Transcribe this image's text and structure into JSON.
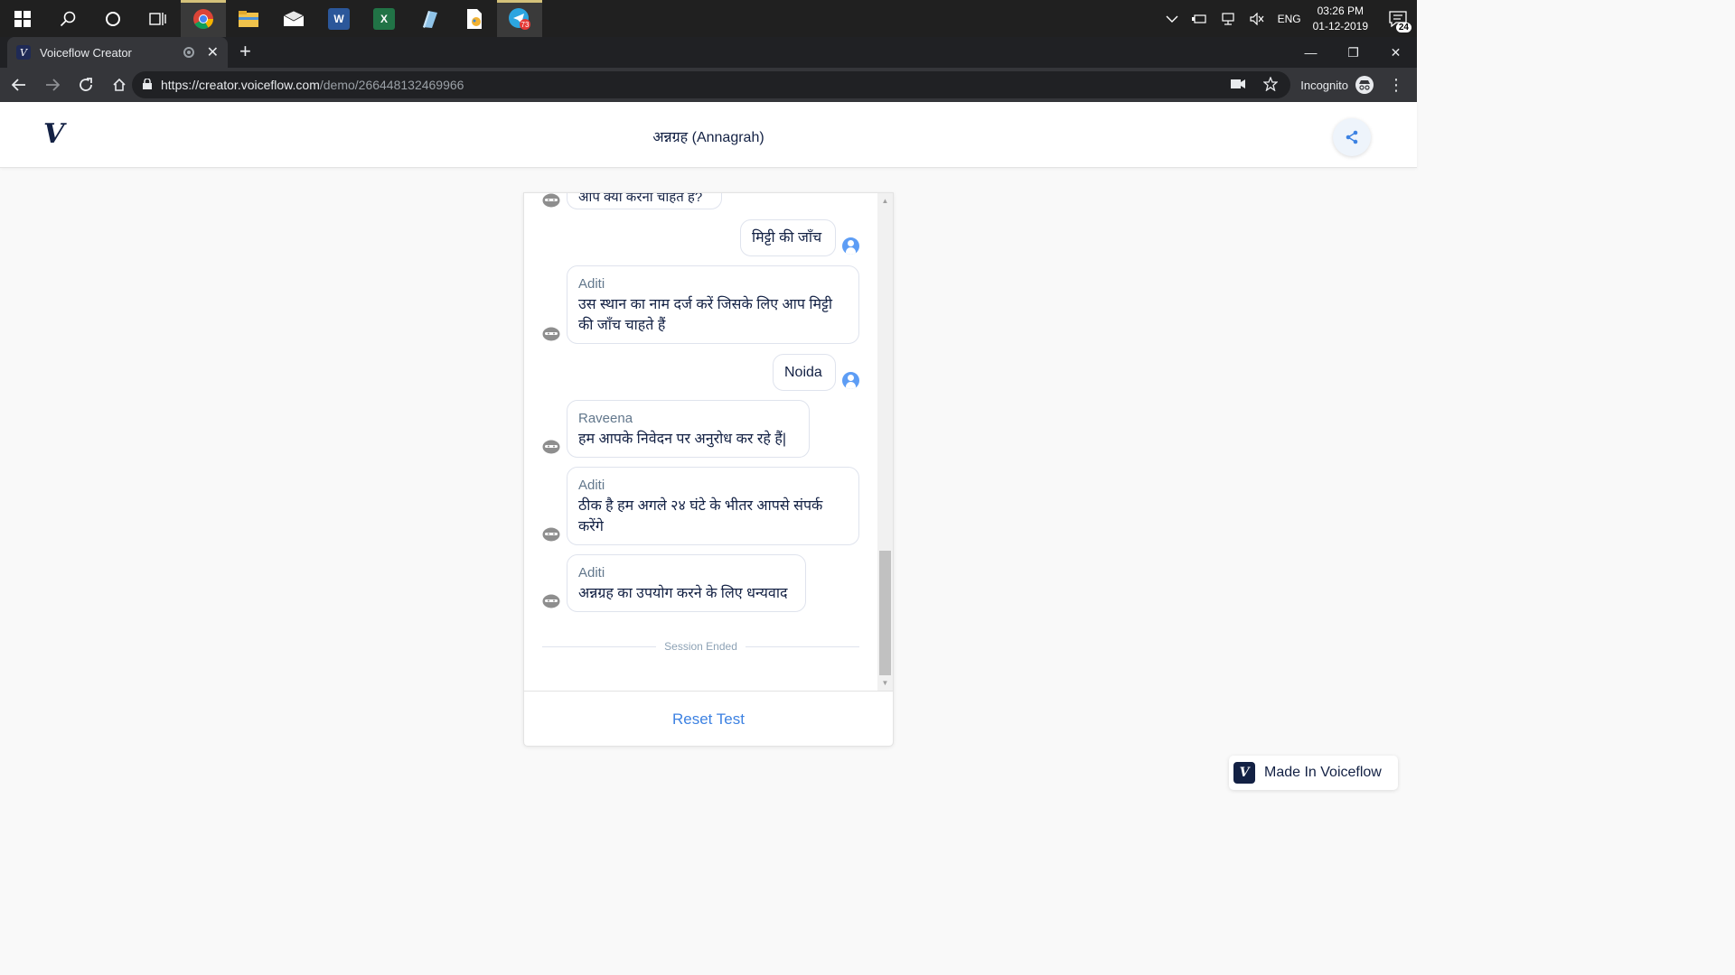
{
  "taskbar": {
    "apps": [
      "start",
      "search",
      "cortana",
      "task-view",
      "chrome",
      "file-explorer",
      "mail",
      "word",
      "excel",
      "notepad",
      "paint",
      "telegram"
    ],
    "telegram_badge": "73",
    "tray": {
      "language": "ENG",
      "time": "03:26 PM",
      "date": "01-12-2019",
      "notifications": "24"
    }
  },
  "browser": {
    "tab_title": "Voiceflow Creator",
    "url_main": "https://creator.voiceflow.com",
    "url_path": "/demo/266448132469966",
    "incognito_label": "Incognito"
  },
  "app": {
    "logo": "V",
    "title": "अन्नग्रह (Annagrah)"
  },
  "chat": {
    "partial_top_text": "आप क्या करना चाहते हैं?",
    "messages": [
      {
        "from": "user",
        "text": "मिट्टी की जाँच"
      },
      {
        "from": "bot",
        "speaker": "Aditi",
        "text": "उस स्थान का नाम दर्ज करें जिसके लिए आप मिट्टी की जाँच चाहते हैं"
      },
      {
        "from": "user",
        "text": "Noida"
      },
      {
        "from": "bot",
        "speaker": "Raveena",
        "text": "हम आपके निवेदन पर अनुरोध कर रहे हैं|"
      },
      {
        "from": "bot",
        "speaker": "Aditi",
        "text": "ठीक है हम अगले २४ घंटे के भीतर आपसे संपर्क करेंगे"
      },
      {
        "from": "bot",
        "speaker": "Aditi",
        "text": "अन्नग्रह का उपयोग करने के लिए धन्यवाद"
      }
    ],
    "session_ended": "Session Ended",
    "reset_label": "Reset Test"
  },
  "made_in": {
    "label": "Made In Voiceflow",
    "logo": "V"
  },
  "colors": {
    "accent": "#3d82e2",
    "navy": "#132144",
    "user_avatar": "#5d9df5"
  }
}
